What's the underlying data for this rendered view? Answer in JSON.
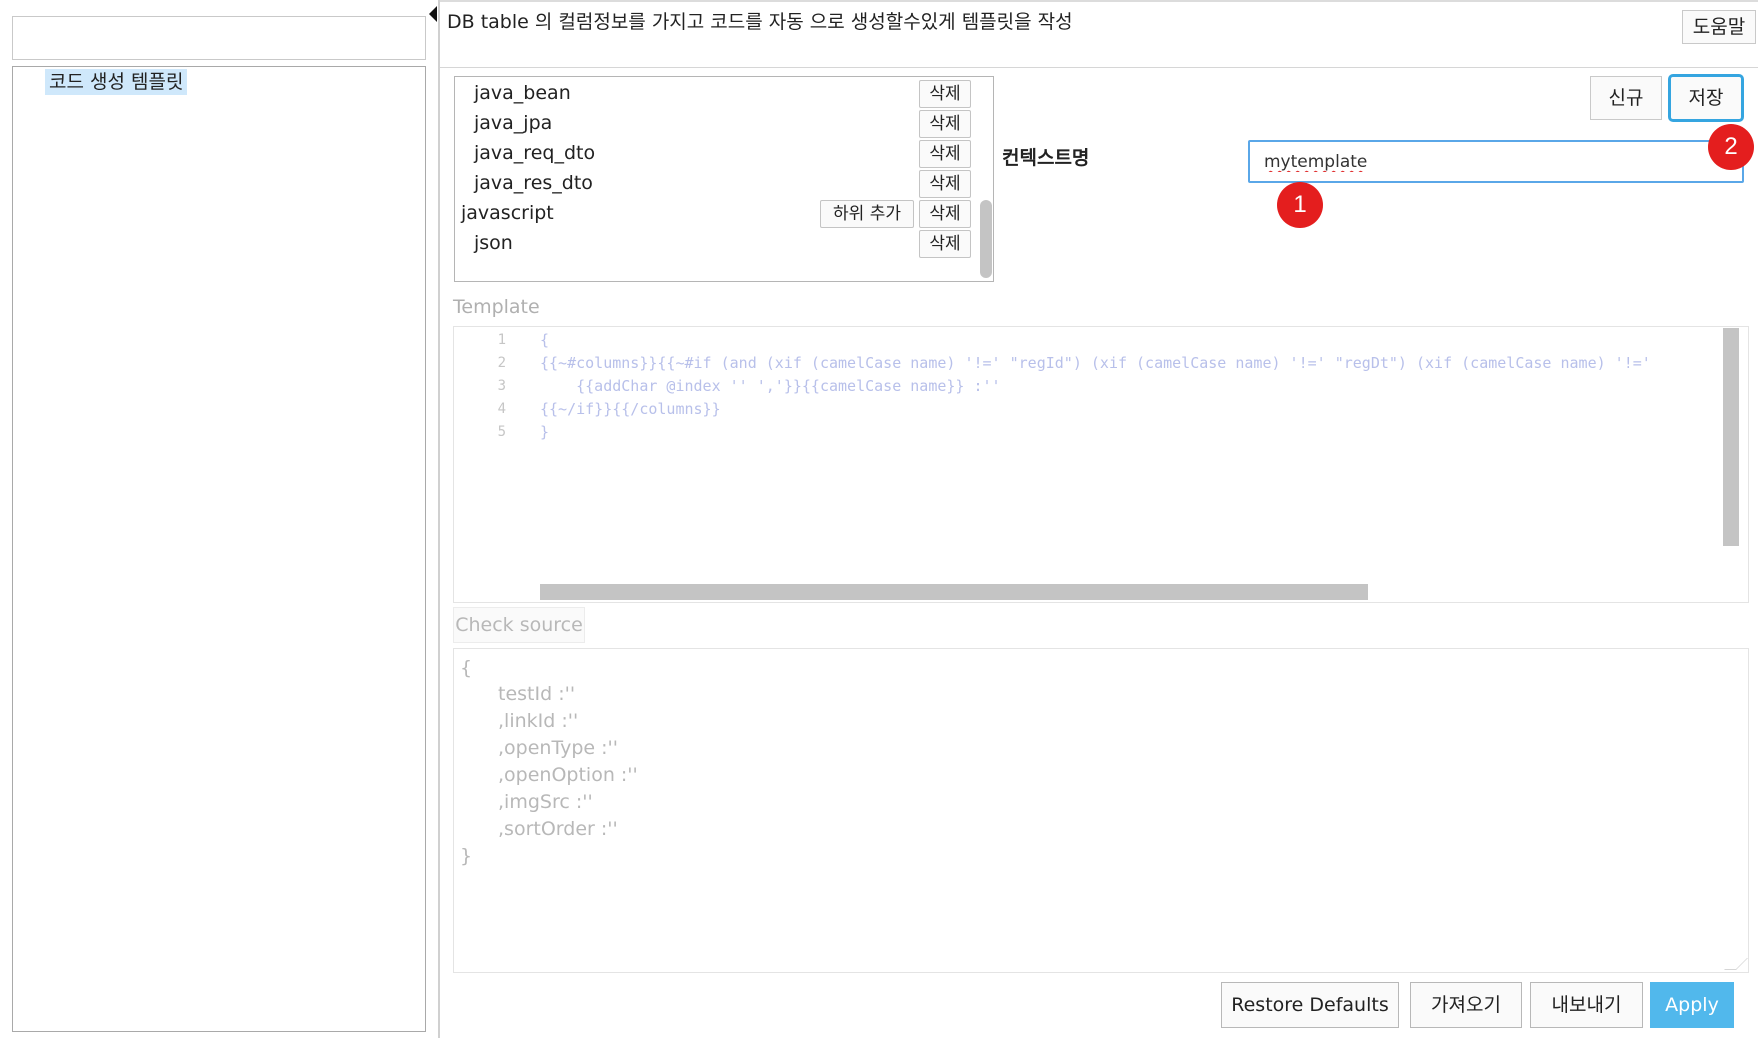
{
  "tree": {
    "filter_value": "",
    "selected_node": "코드 생성 템플릿"
  },
  "header": {
    "description": "DB table 의 컬럼정보를 가지고 코드를 자동 으로 생성할수있게 템플릿을 작성",
    "help_label": "도움말"
  },
  "list": {
    "delete_label": "삭제",
    "add_child_label": "하위 추가",
    "items": [
      {
        "name": "java_bean",
        "level": 1
      },
      {
        "name": "java_jpa",
        "level": 1
      },
      {
        "name": "java_req_dto",
        "level": 1
      },
      {
        "name": "java_res_dto",
        "level": 1
      },
      {
        "name": "javascript",
        "level": 0
      },
      {
        "name": "json",
        "level": 1
      }
    ]
  },
  "form": {
    "new_label": "신규",
    "save_label": "저장",
    "context_label": "컨텍스트명",
    "context_value": "mytemplate",
    "markers": [
      "1",
      "2"
    ]
  },
  "template": {
    "label": "Template",
    "line_numbers": [
      "1",
      "2",
      "3",
      "4",
      "5"
    ],
    "lines": [
      "{",
      "{{~#columns}}{{~#if (and (xif (camelCase name) '!=' \"regId\") (xif (camelCase name) '!=' \"regDt\") (xif (camelCase name) '!='",
      "    {{addChar @index '' ','}}{{camelCase name}} :''",
      "{{~/if}}{{/columns}}",
      "}"
    ]
  },
  "check_source": {
    "label": "Check source",
    "lines": [
      "{",
      "testId :''",
      ",linkId :''",
      ",openType :''",
      ",openOption :''",
      ",imgSrc :''",
      ",sortOrder :''",
      "}"
    ]
  },
  "footer": {
    "restore_label": "Restore Defaults",
    "import_label": "가져오기",
    "export_label": "내보내기",
    "apply_label": "Apply"
  },
  "colors": {
    "accent": "#51b8ec",
    "focus": "#35a5e0",
    "marker": "#e41e1e",
    "selection": "#cfe8fb"
  }
}
